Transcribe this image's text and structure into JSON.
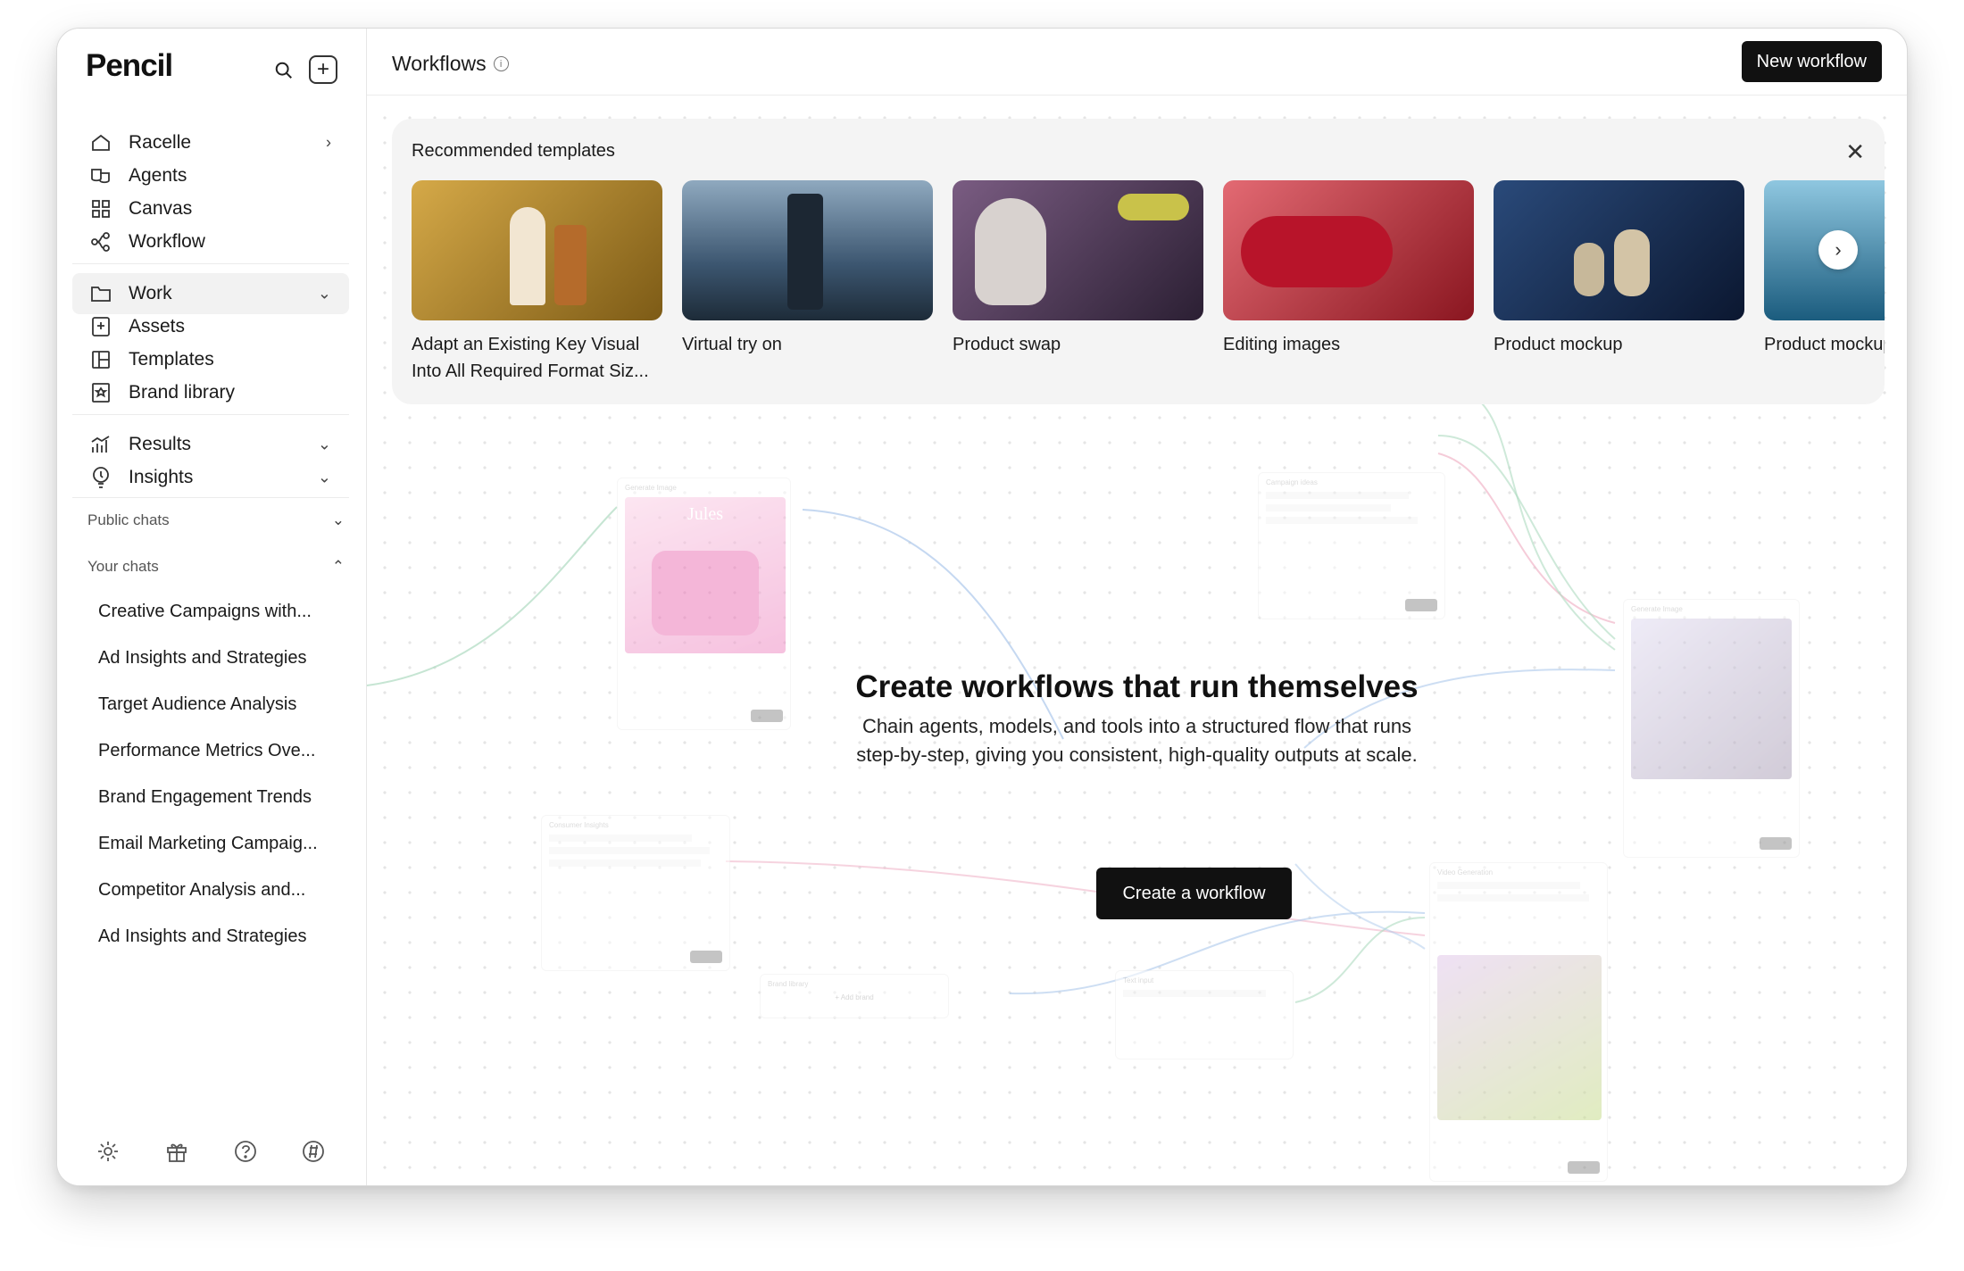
{
  "app": {
    "name": "Pencil"
  },
  "sidebar": {
    "nav_primary": [
      {
        "label": "Racelle",
        "icon": "home-icon",
        "has_chevron": true
      },
      {
        "label": "Agents",
        "icon": "agents-icon"
      },
      {
        "label": "Canvas",
        "icon": "grid-icon"
      },
      {
        "label": "Workflow",
        "icon": "workflow-icon"
      }
    ],
    "nav_work": [
      {
        "label": "Work",
        "icon": "folder-icon",
        "expanded": true
      },
      {
        "label": "Assets",
        "icon": "assets-icon"
      },
      {
        "label": "Templates",
        "icon": "templates-icon"
      },
      {
        "label": "Brand library",
        "icon": "brand-icon"
      }
    ],
    "nav_results": [
      {
        "label": "Results",
        "icon": "chart-icon"
      },
      {
        "label": "Insights",
        "icon": "bulb-icon"
      }
    ],
    "public_chats_label": "Public chats",
    "your_chats_label": "Your chats",
    "chats": [
      "Creative Campaigns with...",
      "Ad Insights and Strategies",
      "Target Audience Analysis",
      "Performance Metrics Ove...",
      "Brand Engagement Trends",
      "Email Marketing Campaig...",
      "Competitor Analysis and...",
      "Ad Insights and Strategies"
    ],
    "footer_icons": [
      "settings-icon",
      "gift-icon",
      "help-icon",
      "discord-icon"
    ]
  },
  "header": {
    "title": "Workflows",
    "new_button": "New workflow"
  },
  "recommended": {
    "title": "Recommended templates",
    "templates": [
      {
        "label": "Adapt an Existing Key Visual Into All Required Format Siz...",
        "colors": [
          "#c49a3c",
          "#8a6a1f"
        ]
      },
      {
        "label": "Virtual try on",
        "colors": [
          "#5f7b94",
          "#23364a"
        ]
      },
      {
        "label": "Product swap",
        "colors": [
          "#6a4f6f",
          "#2d2133"
        ]
      },
      {
        "label": "Editing images",
        "colors": [
          "#c2283a",
          "#6e0f1c"
        ]
      },
      {
        "label": "Product mockup",
        "colors": [
          "#1f3b66",
          "#0c1a33"
        ]
      },
      {
        "label": "Product mockup",
        "colors": [
          "#2f7da3",
          "#0f3b55"
        ]
      }
    ]
  },
  "hero": {
    "title": "Create workflows that run themselves",
    "line1": "Chain agents, models, and tools into a structured flow that runs",
    "line2": "step-by-step, giving you consistent, high-quality outputs at scale.",
    "cta": "Create a workflow"
  },
  "canvas_nodes": {
    "generate_image": "Generate Image",
    "campaign_ideas": "Campaign ideas",
    "consumer_insights": "Consumer Insights",
    "brand_library": "Brand library",
    "add_brand": "+ Add brand",
    "text_input": "Text input",
    "video_generation": "Video Generation",
    "jules": "Jules",
    "run": "Run"
  },
  "colors": {
    "accent": "#111111",
    "wire_blue": "#7aa7e0",
    "wire_pink": "#e88aa8",
    "wire_green": "#7cc49a"
  }
}
